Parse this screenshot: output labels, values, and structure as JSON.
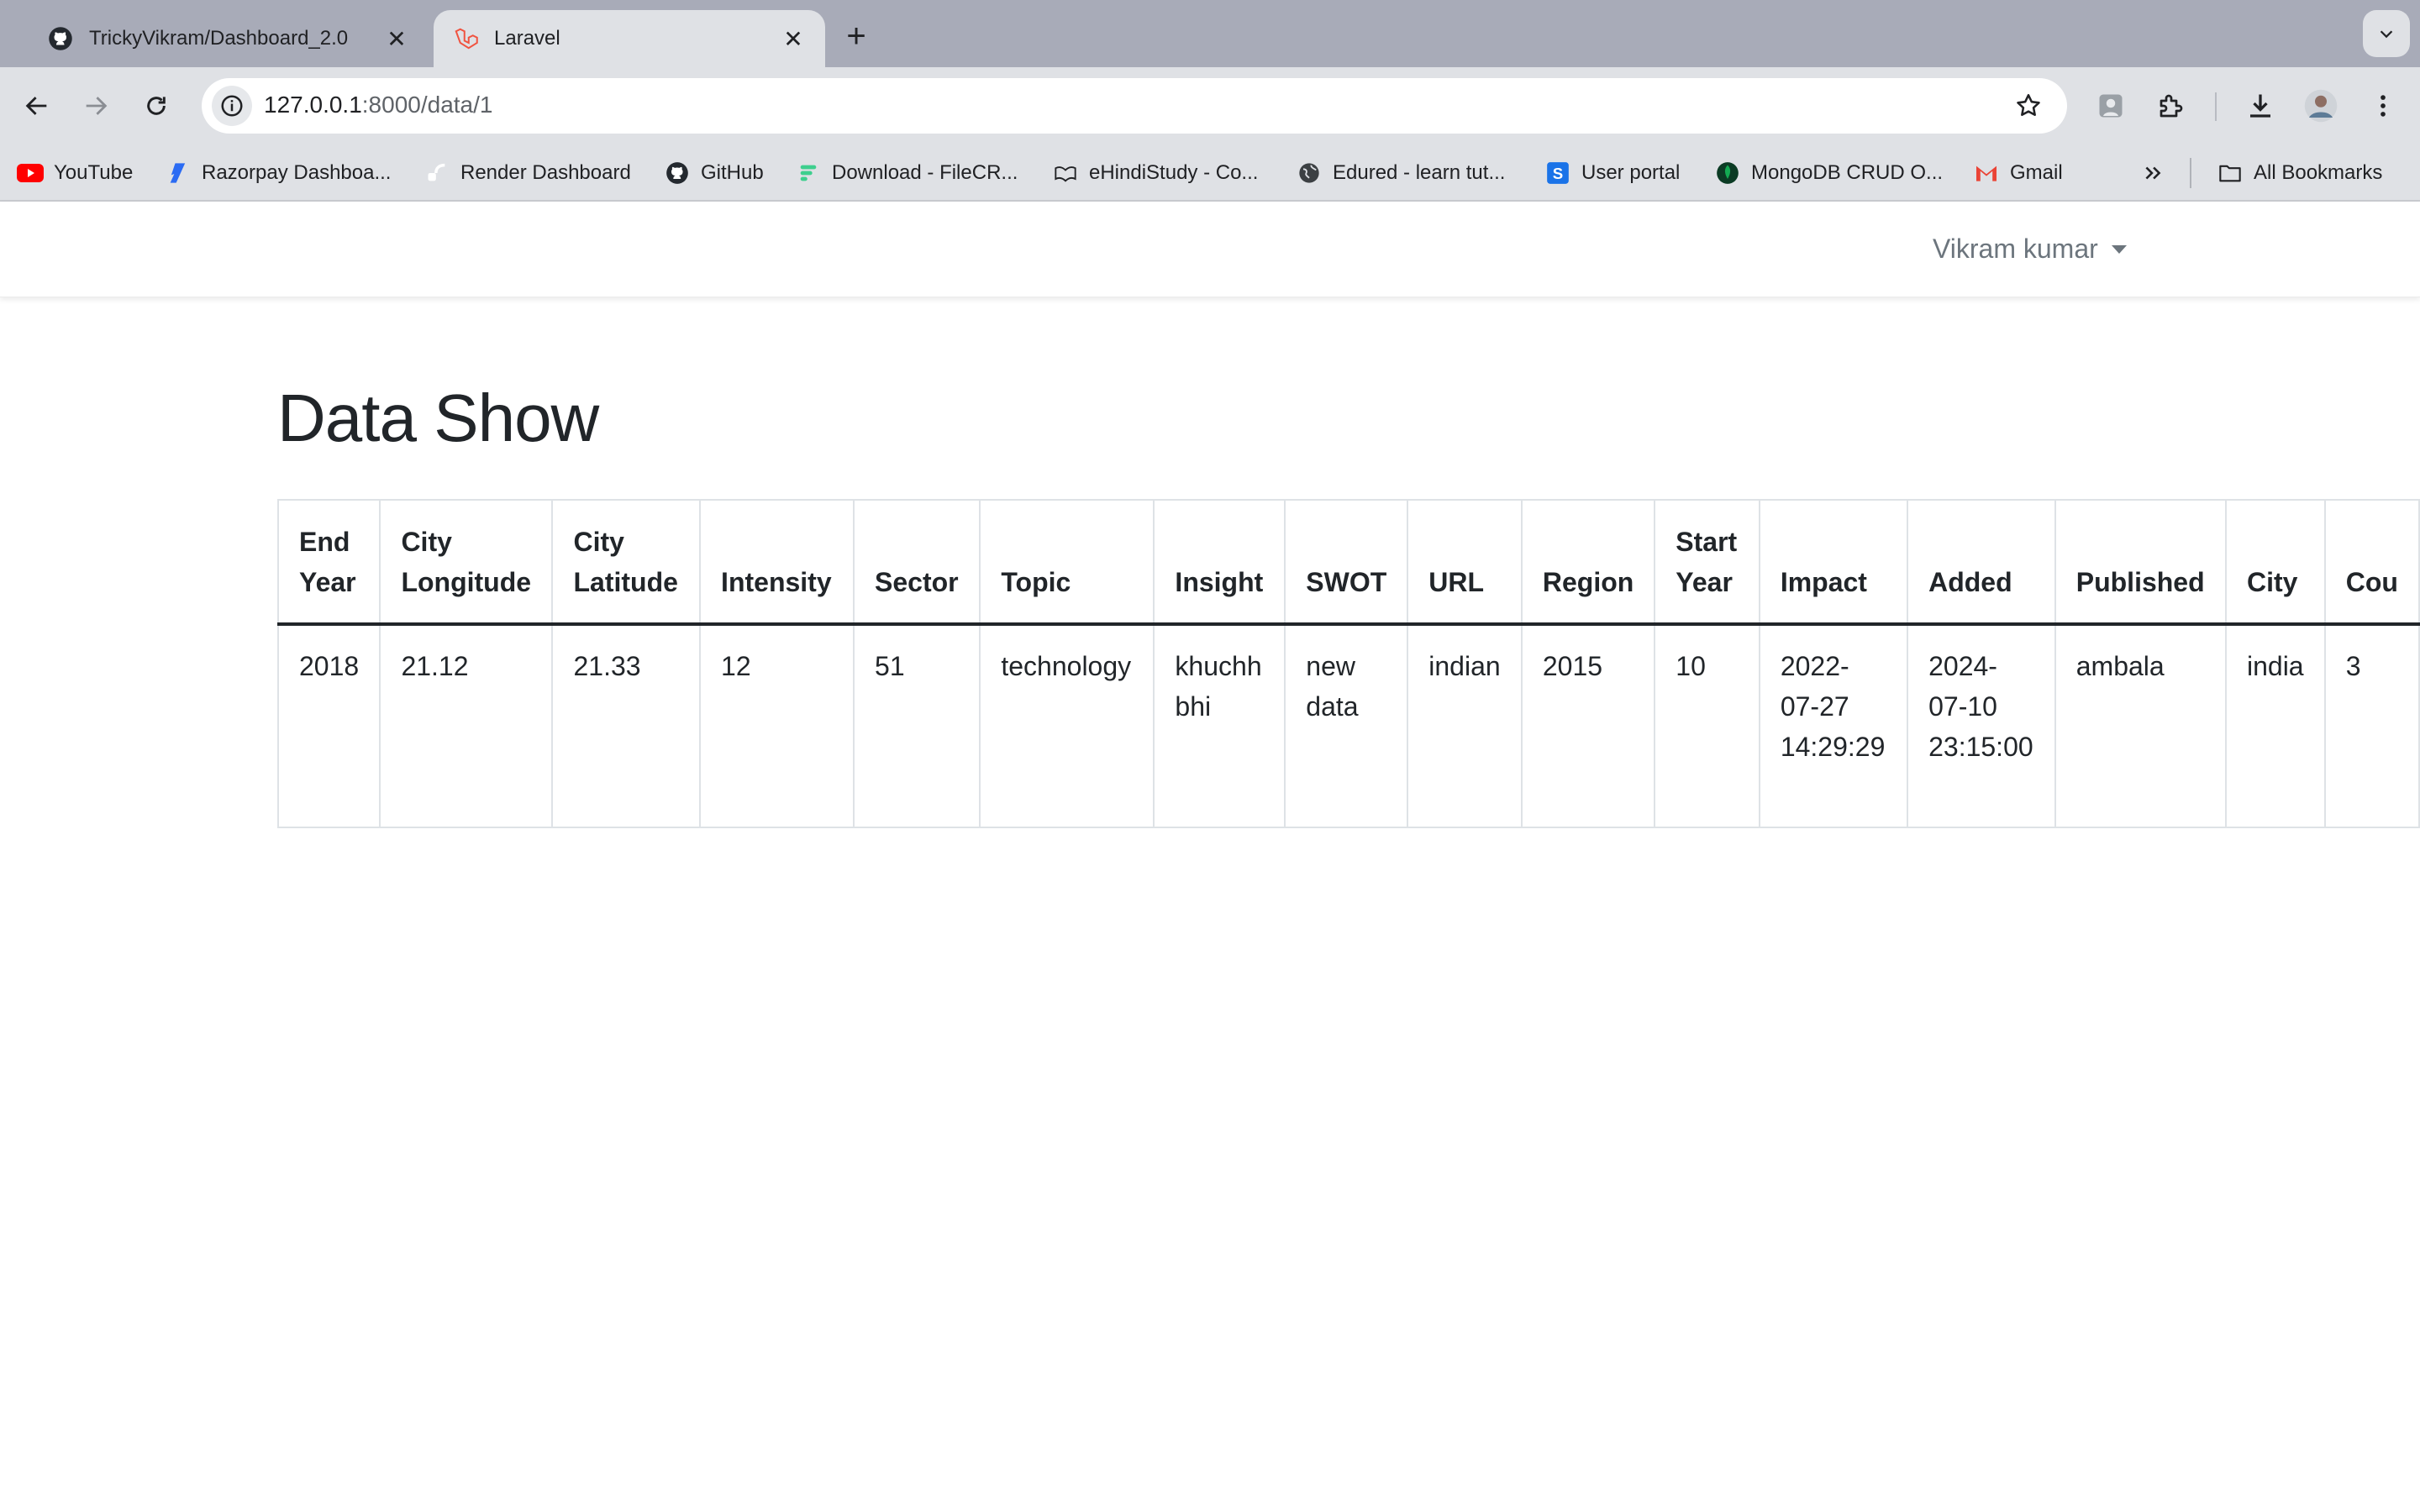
{
  "browser": {
    "tabs": [
      {
        "title": "TrickyVikram/Dashboard_2.0",
        "icon": "github-icon",
        "active": false
      },
      {
        "title": "Laravel",
        "icon": "laravel-icon",
        "active": true
      }
    ],
    "url_host": "127.0.0.1",
    "url_path": ":8000/data/1",
    "bookmarks": [
      {
        "label": "YouTube",
        "icon": "youtube-icon"
      },
      {
        "label": "Razorpay Dashboa...",
        "icon": "razorpay-icon"
      },
      {
        "label": "Render Dashboard",
        "icon": "render-icon"
      },
      {
        "label": "GitHub",
        "icon": "github-icon"
      },
      {
        "label": "Download - FileCR...",
        "icon": "filecr-icon"
      },
      {
        "label": "eHindiStudy - Co...",
        "icon": "ehindistudy-icon"
      },
      {
        "label": "Edured - learn tut...",
        "icon": "globe-icon"
      },
      {
        "label": "User portal",
        "icon": "s-logo-icon"
      },
      {
        "label": "MongoDB CRUD O...",
        "icon": "mongodb-icon"
      },
      {
        "label": "Gmail",
        "icon": "gmail-icon"
      }
    ],
    "all_bookmarks_label": "All Bookmarks"
  },
  "navbar": {
    "user_name": "Vikram kumar"
  },
  "page": {
    "title": "Data Show"
  },
  "table": {
    "columns": [
      "End Year",
      "City Longitude",
      "City Latitude",
      "Intensity",
      "Sector",
      "Topic",
      "Insight",
      "SWOT",
      "URL",
      "Region",
      "Start Year",
      "Impact",
      "Added",
      "Published",
      "City",
      "Cou"
    ],
    "rows": [
      [
        "2018",
        "21.12",
        "21.33",
        "12",
        "51",
        "technology",
        "khuchh bhi",
        "new data",
        "indian",
        "2015",
        "10",
        "2022-07-27 14:29:29",
        "2024-07-10 23:15:00",
        "ambala",
        "india",
        "3"
      ]
    ]
  },
  "colors": {
    "tabstrip": "#a8abb8",
    "toolbar": "#dfe1e5",
    "text": "#212529",
    "muted": "#6c757d",
    "border": "#dee2e6"
  }
}
